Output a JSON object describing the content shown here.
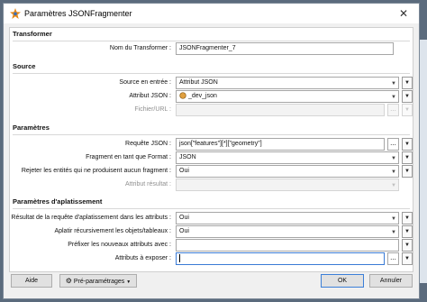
{
  "window": {
    "title": "Paramètres JSONFragmenter",
    "close_glyph": "✕",
    "app_icon": "fme-workbench-icon"
  },
  "sections": {
    "transformer": "Transformer",
    "source": "Source",
    "parametres": "Paramètres",
    "aplatissement": "Paramètres d'aplatissement"
  },
  "transformer": {
    "name_label": "Nom du Transformer :",
    "name_value": "JSONFragmenter_7"
  },
  "source": {
    "input_label": "Source en entrée :",
    "input_value": "Attribut JSON",
    "attribute_label": "Attribut JSON :",
    "attribute_value": "_dev_json",
    "file_label": "Fichier/URL :",
    "file_value": ""
  },
  "parametres": {
    "query_label": "Requête JSON :",
    "query_value": "json[\"features\"][*][\"geometry\"]",
    "format_label": "Fragment en tant que Format :",
    "format_value": "JSON",
    "reject_label": "Rejeter les entités qui ne produisent aucun fragment :",
    "reject_value": "Oui",
    "result_attr_label": "Attribut résultat :",
    "result_attr_value": ""
  },
  "aplatissement": {
    "flatten_query_label": "Résultat de la requête d'aplatissement dans les attributs :",
    "flatten_query_value": "Oui",
    "recursive_label": "Aplatir récursivement les objets/tableaux :",
    "recursive_value": "Oui",
    "prefix_label": "Préfixer les nouveaux attributs avec :",
    "prefix_value": "",
    "expose_label": "Attributs à exposer :",
    "expose_value": ""
  },
  "buttons": {
    "help": "Aide",
    "presets": "Pré-paramétrages",
    "ok": "OK",
    "cancel": "Annuler",
    "ellipsis": "...",
    "dropdown_glyph": "▼"
  }
}
